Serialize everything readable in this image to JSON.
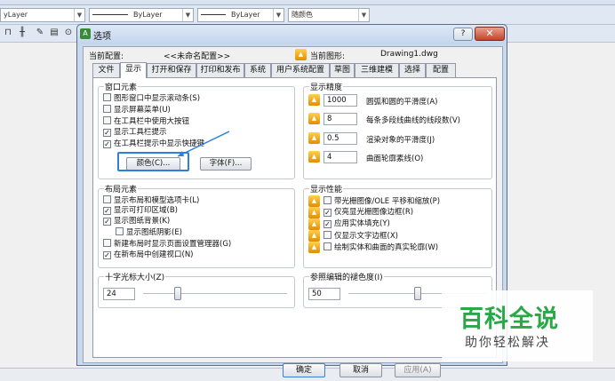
{
  "cad": {
    "layer_combo": "yLayer",
    "linetype_combo": "ByLayer",
    "lineweight_combo": "ByLayer",
    "color_combo": "随颜色"
  },
  "dialog": {
    "title": "选项",
    "help": "?",
    "close": "✕",
    "current_profile_label": "当前配置:",
    "current_profile_value": "<<未命名配置>>",
    "current_drawing_label": "当前图形:",
    "current_drawing_value": "Drawing1.dwg",
    "tabs": [
      "文件",
      "显示",
      "打开和保存",
      "打印和发布",
      "系统",
      "用户系统配置",
      "草图",
      "三维建模",
      "选择",
      "配置"
    ],
    "window_elements": {
      "title": "窗口元素",
      "items": [
        {
          "label": "图形窗口中显示滚动条(S)",
          "checked": false
        },
        {
          "label": "显示屏幕菜单(U)",
          "checked": false
        },
        {
          "label": "在工具栏中使用大按钮",
          "checked": false
        },
        {
          "label": "显示工具栏提示",
          "checked": true
        },
        {
          "label": "在工具栏提示中显示快捷键",
          "checked": true
        }
      ],
      "colors_button": "颜色(C)...",
      "fonts_button": "字体(F)..."
    },
    "display_resolution": {
      "title": "显示精度",
      "items": [
        {
          "value": "1000",
          "label": "圆弧和圆的平滑度(A)"
        },
        {
          "value": "8",
          "label": "每条多段线曲线的线段数(V)"
        },
        {
          "value": "0.5",
          "label": "渲染对象的平滑度(J)"
        },
        {
          "value": "4",
          "label": "曲面轮廓素线(O)"
        }
      ]
    },
    "layout_elements": {
      "title": "布局元素",
      "items": [
        {
          "label": "显示布局和模型选项卡(L)",
          "checked": false
        },
        {
          "label": "显示可打印区域(B)",
          "checked": true
        },
        {
          "label": "显示图纸背景(K)",
          "checked": true
        },
        {
          "label": "显示图纸阴影(E)",
          "checked": false
        },
        {
          "label": "新建布局时显示页面设置管理器(G)",
          "checked": false
        },
        {
          "label": "在新布局中创建视口(N)",
          "checked": true
        }
      ]
    },
    "display_performance": {
      "title": "显示性能",
      "items": [
        {
          "label": "带光栅图像/OLE 平移和缩放(P)",
          "checked": false
        },
        {
          "label": "仅亮显光栅图像边框(R)",
          "checked": true
        },
        {
          "label": "应用实体填充(Y)",
          "checked": true
        },
        {
          "label": "仅显示文字边框(X)",
          "checked": false
        },
        {
          "label": "绘制实体和曲面的真实轮廓(W)",
          "checked": false
        }
      ]
    },
    "crosshair": {
      "title": "十字光标大小(Z)",
      "value": "24",
      "level": 0.24
    },
    "xref_fade": {
      "title": "参照编辑的褪色度(I)",
      "value": "50",
      "level": 0.5
    },
    "ok": "确定",
    "cancel": "取消",
    "apply": "应用(A)"
  },
  "watermark": {
    "title": "百科全说",
    "subtitle": "助你轻松解决"
  }
}
